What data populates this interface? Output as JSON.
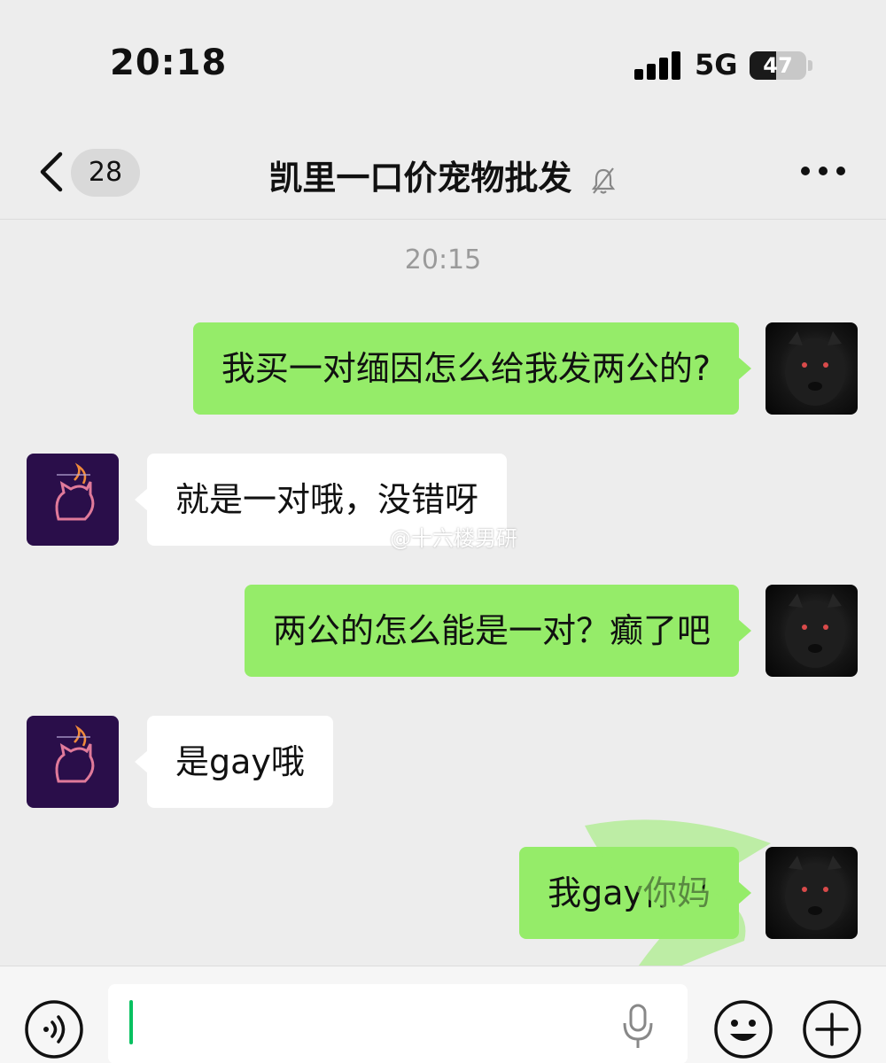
{
  "status_bar": {
    "time": "20:18",
    "network": "5G",
    "battery": "47",
    "battery_level": 0.47
  },
  "nav": {
    "unread_count": "28",
    "title": "凯里一口价宠物批发"
  },
  "timestamp": "20:15",
  "messages": [
    {
      "side": "right",
      "text": "我买一对缅因怎么给我发两公的?"
    },
    {
      "side": "left",
      "text": "就是一对哦，没错呀"
    },
    {
      "side": "right",
      "text": "两公的怎么能是一对？癫了吧"
    },
    {
      "side": "left",
      "text": "是gay哦"
    },
    {
      "side": "right",
      "text": "我gay你妈"
    }
  ],
  "watermark": "@十六楼男研",
  "colors": {
    "my_bubble": "#95ec69",
    "other_bubble": "#ffffff",
    "background": "#ededed",
    "cursor": "#07c160"
  },
  "icons": [
    "back-icon",
    "mute-bell-icon",
    "more-icon",
    "voice-icon",
    "mic-icon",
    "emoji-icon",
    "plus-icon"
  ]
}
